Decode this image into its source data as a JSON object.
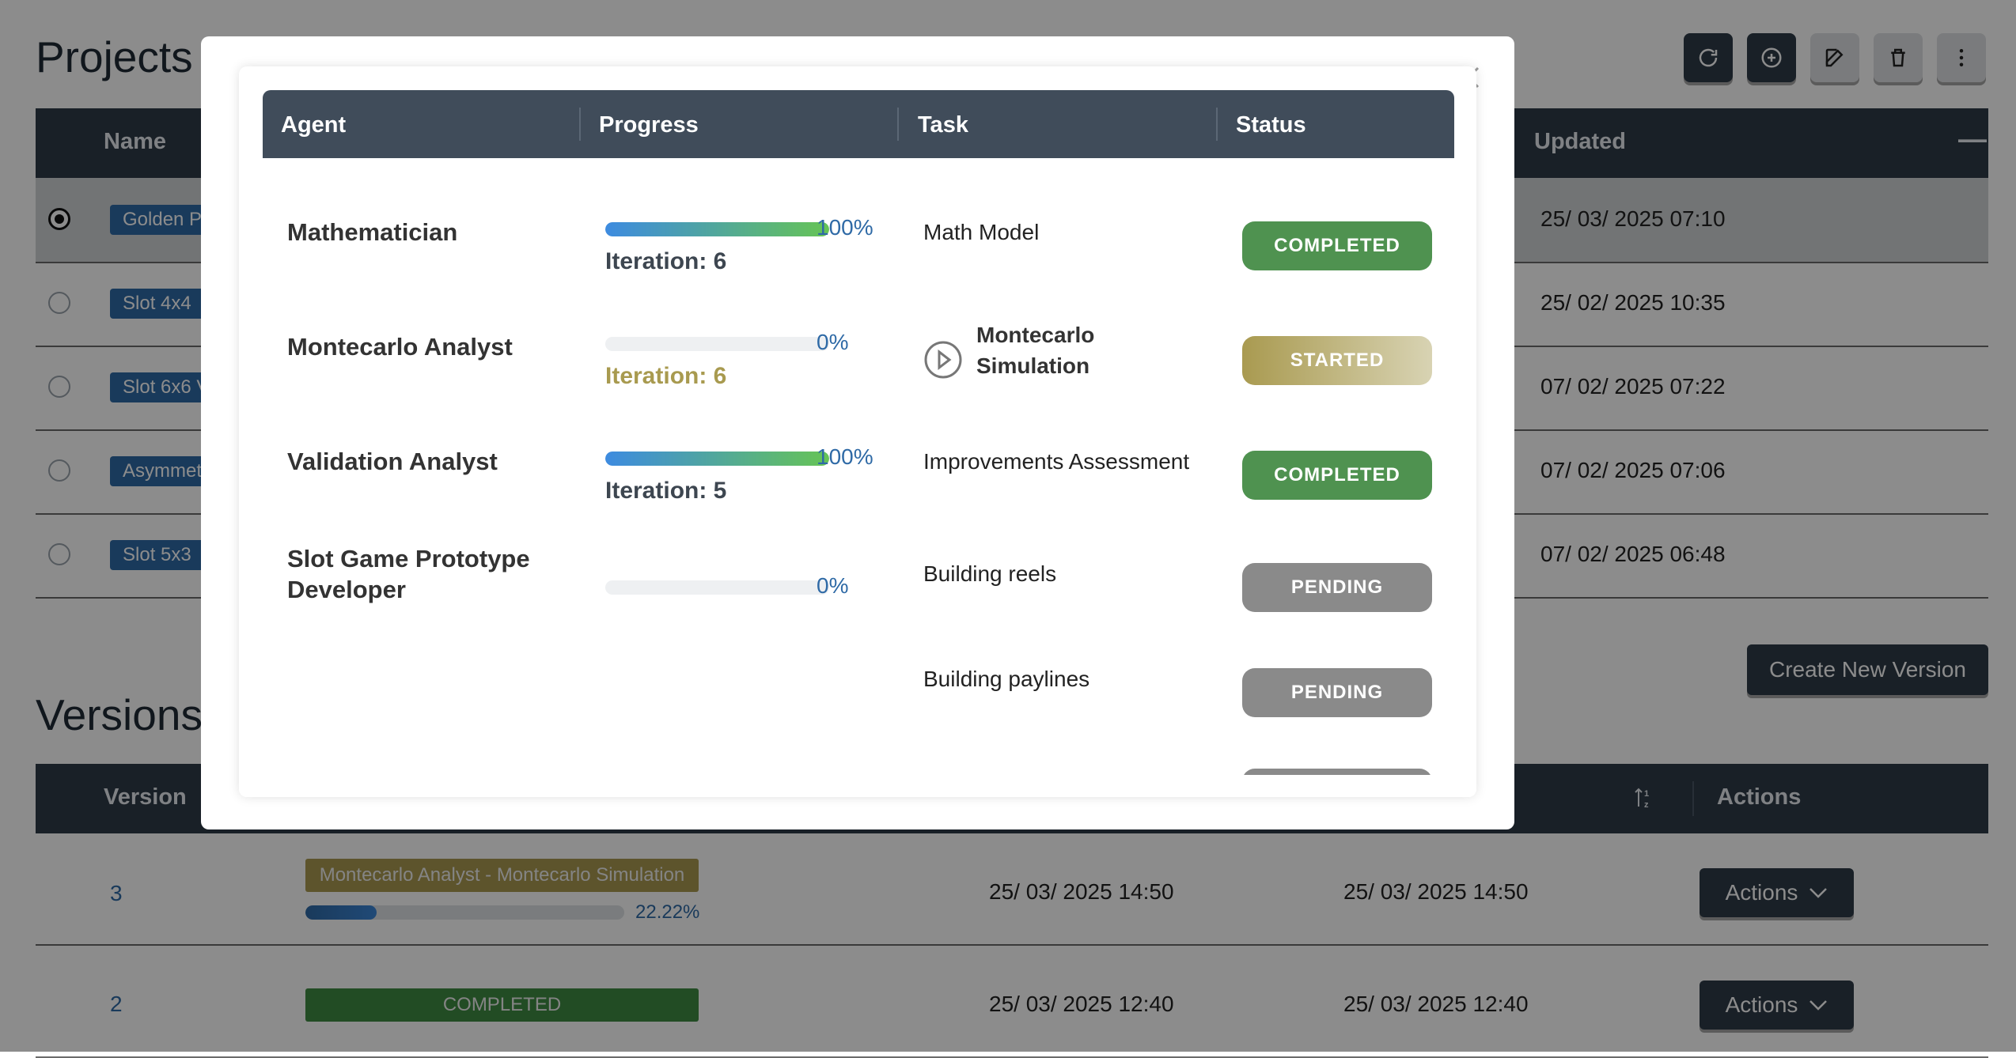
{
  "projects": {
    "title": "Projects (",
    "toolbar": [
      "refresh-icon",
      "add-circle-icon",
      "edit-icon",
      "trash-icon",
      "more-vertical-icon"
    ],
    "columns": {
      "name": "Name",
      "updated": "Updated",
      "collapse": "—"
    },
    "rows": [
      {
        "name": "Golden P",
        "updated": "25/ 03/ 2025 07:10",
        "selected": true
      },
      {
        "name": "Slot 4x4",
        "updated": "25/ 02/ 2025 10:35",
        "selected": false
      },
      {
        "name": "Slot 6x6 V",
        "updated": "07/ 02/ 2025 07:22",
        "selected": false
      },
      {
        "name": "Asymmet",
        "updated": "07/ 02/ 2025 07:06",
        "selected": false
      },
      {
        "name": "Slot 5x3",
        "updated": "07/ 02/ 2025 06:48",
        "selected": false
      }
    ]
  },
  "create_version_label": "Create New Version",
  "versions": {
    "title": "Versions",
    "columns": {
      "version": "Version",
      "actions": "Actions",
      "sort_icon": "sort-icon"
    },
    "rows": [
      {
        "version": "3",
        "stage": "Montecarlo Analyst - Montecarlo Simulation",
        "progress_pct": "22.22%",
        "progress": 0.2222,
        "created": "25/ 03/ 2025 14:50",
        "updated": "25/ 03/ 2025 14:50",
        "actions": "Actions"
      },
      {
        "version": "2",
        "stage": "COMPLETED",
        "created": "25/ 03/ 2025 12:40",
        "updated": "25/ 03/ 2025 12:40",
        "actions": "Actions"
      }
    ]
  },
  "modal": {
    "columns": {
      "agent": "Agent",
      "progress": "Progress",
      "task": "Task",
      "status": "Status"
    },
    "rows": [
      {
        "agent": "Mathematician",
        "progress": 1.0,
        "pct": "100%",
        "iteration": "Iteration: 6",
        "task": "Math Model",
        "status": "COMPLETED"
      },
      {
        "agent": "Montecarlo Analyst",
        "progress": 0.0,
        "pct": "0%",
        "iteration": "Iteration: 6",
        "task_line1": "Montecarlo",
        "task_line2": "Simulation",
        "status": "STARTED"
      },
      {
        "agent": "Validation Analyst",
        "progress": 1.0,
        "pct": "100%",
        "iteration": "Iteration: 5",
        "task": "Improvements Assessment",
        "status": "COMPLETED"
      },
      {
        "agent_line1": "Slot Game Prototype",
        "agent_line2": "Developer",
        "progress": 0.0,
        "pct": "0%",
        "task": "Building reels",
        "status": "PENDING"
      },
      {
        "task": "Building paylines",
        "status": "PENDING"
      }
    ]
  },
  "colors": {
    "header": "#2e3b48",
    "completed": "#4f9250",
    "started": "#a99a50",
    "pending": "#8a8a8a",
    "link": "#2f6aa6"
  }
}
